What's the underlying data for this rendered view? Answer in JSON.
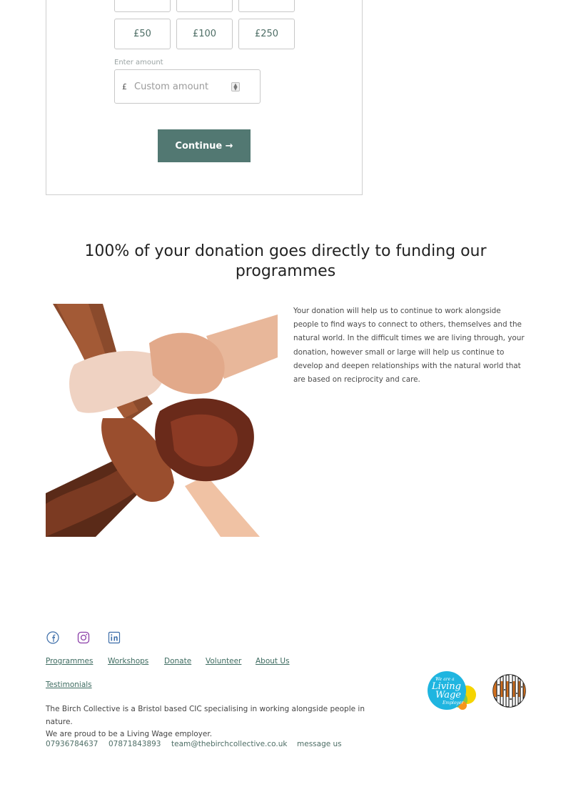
{
  "donation": {
    "amounts_top_row": [
      "",
      "",
      ""
    ],
    "amounts": [
      "£50",
      "£100",
      "£250"
    ],
    "enter_amount_label": "Enter amount",
    "currency_symbol": "£",
    "custom_placeholder": "Custom amount",
    "continue_label": "Continue →"
  },
  "headline": "100% of your donation goes directly to funding our programmes",
  "body_text": "Your donation will help us to continue to work alongside people to find ways to connect to others, themselves and the natural world. In the difficult times we are living through, your donation, however small or large will help us continue to develop and deepen relationships with the natural world that are based on reciprocity and care.",
  "footer": {
    "socials": [
      "facebook-icon",
      "instagram-icon",
      "linkedin-icon"
    ],
    "links": [
      "Programmes",
      "Workshops",
      "Donate",
      "Volunteer",
      "About Us",
      "Testimonials"
    ],
    "about_line1": "The Birch Collective is a Bristol based CIC specialising in working alongside people in nature.",
    "about_line2": "We are proud to be a Living Wage employer.",
    "phone1": "07936784637",
    "phone2": "07871843893",
    "email": "team@thebirchcollective.co.uk",
    "message": "message us",
    "living_wage_badge": {
      "line1": "We are a",
      "line2": "Living",
      "line3": "Wage",
      "line4": "Employer"
    }
  },
  "colors": {
    "accent": "#527872",
    "link": "#3d6b60",
    "social_blue": "#3b6ca8",
    "social_purple": "#8b3fa8"
  }
}
